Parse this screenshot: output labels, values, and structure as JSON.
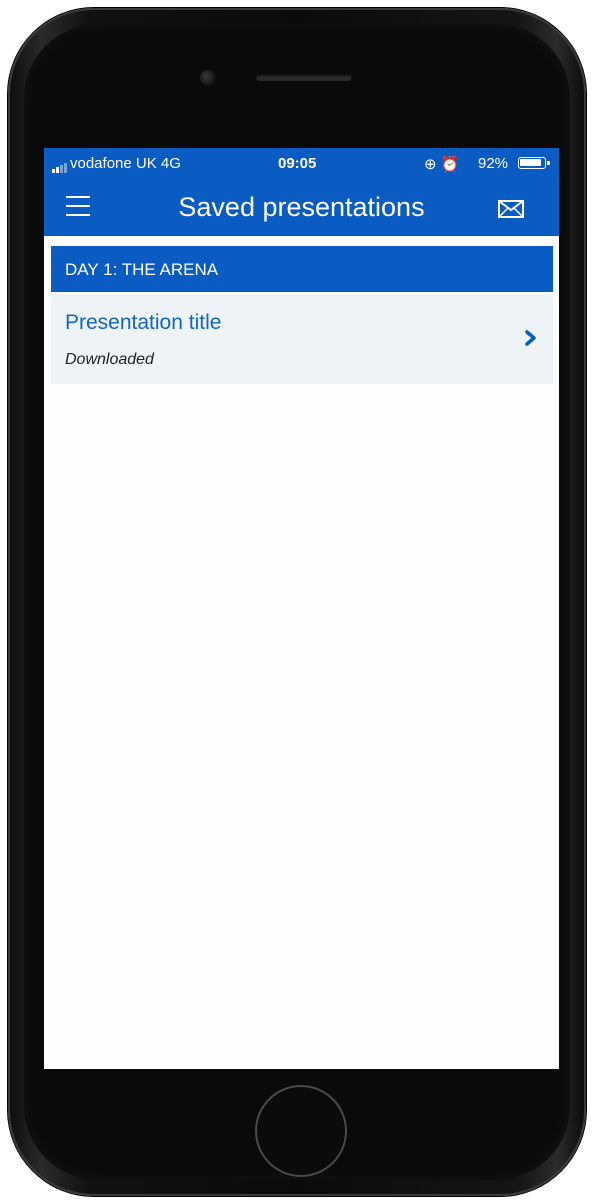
{
  "status_bar": {
    "carrier": "vodafone UK  4G",
    "time": "09:05",
    "icons": "⊕ ⏰",
    "battery_percent": "92%",
    "battery_level": 0.92
  },
  "header": {
    "title": "Saved presentations",
    "menu_icon": "hamburger-menu-icon",
    "mail_icon": "envelope-icon"
  },
  "section": {
    "label": "DAY 1: THE ARENA"
  },
  "items": [
    {
      "title": "Presentation title",
      "status": "Downloaded",
      "icon": "chevron-right-icon"
    }
  ],
  "colors": {
    "primary": "#0a5cc2",
    "item_bg": "#eef3f8",
    "link": "#1565c0"
  }
}
